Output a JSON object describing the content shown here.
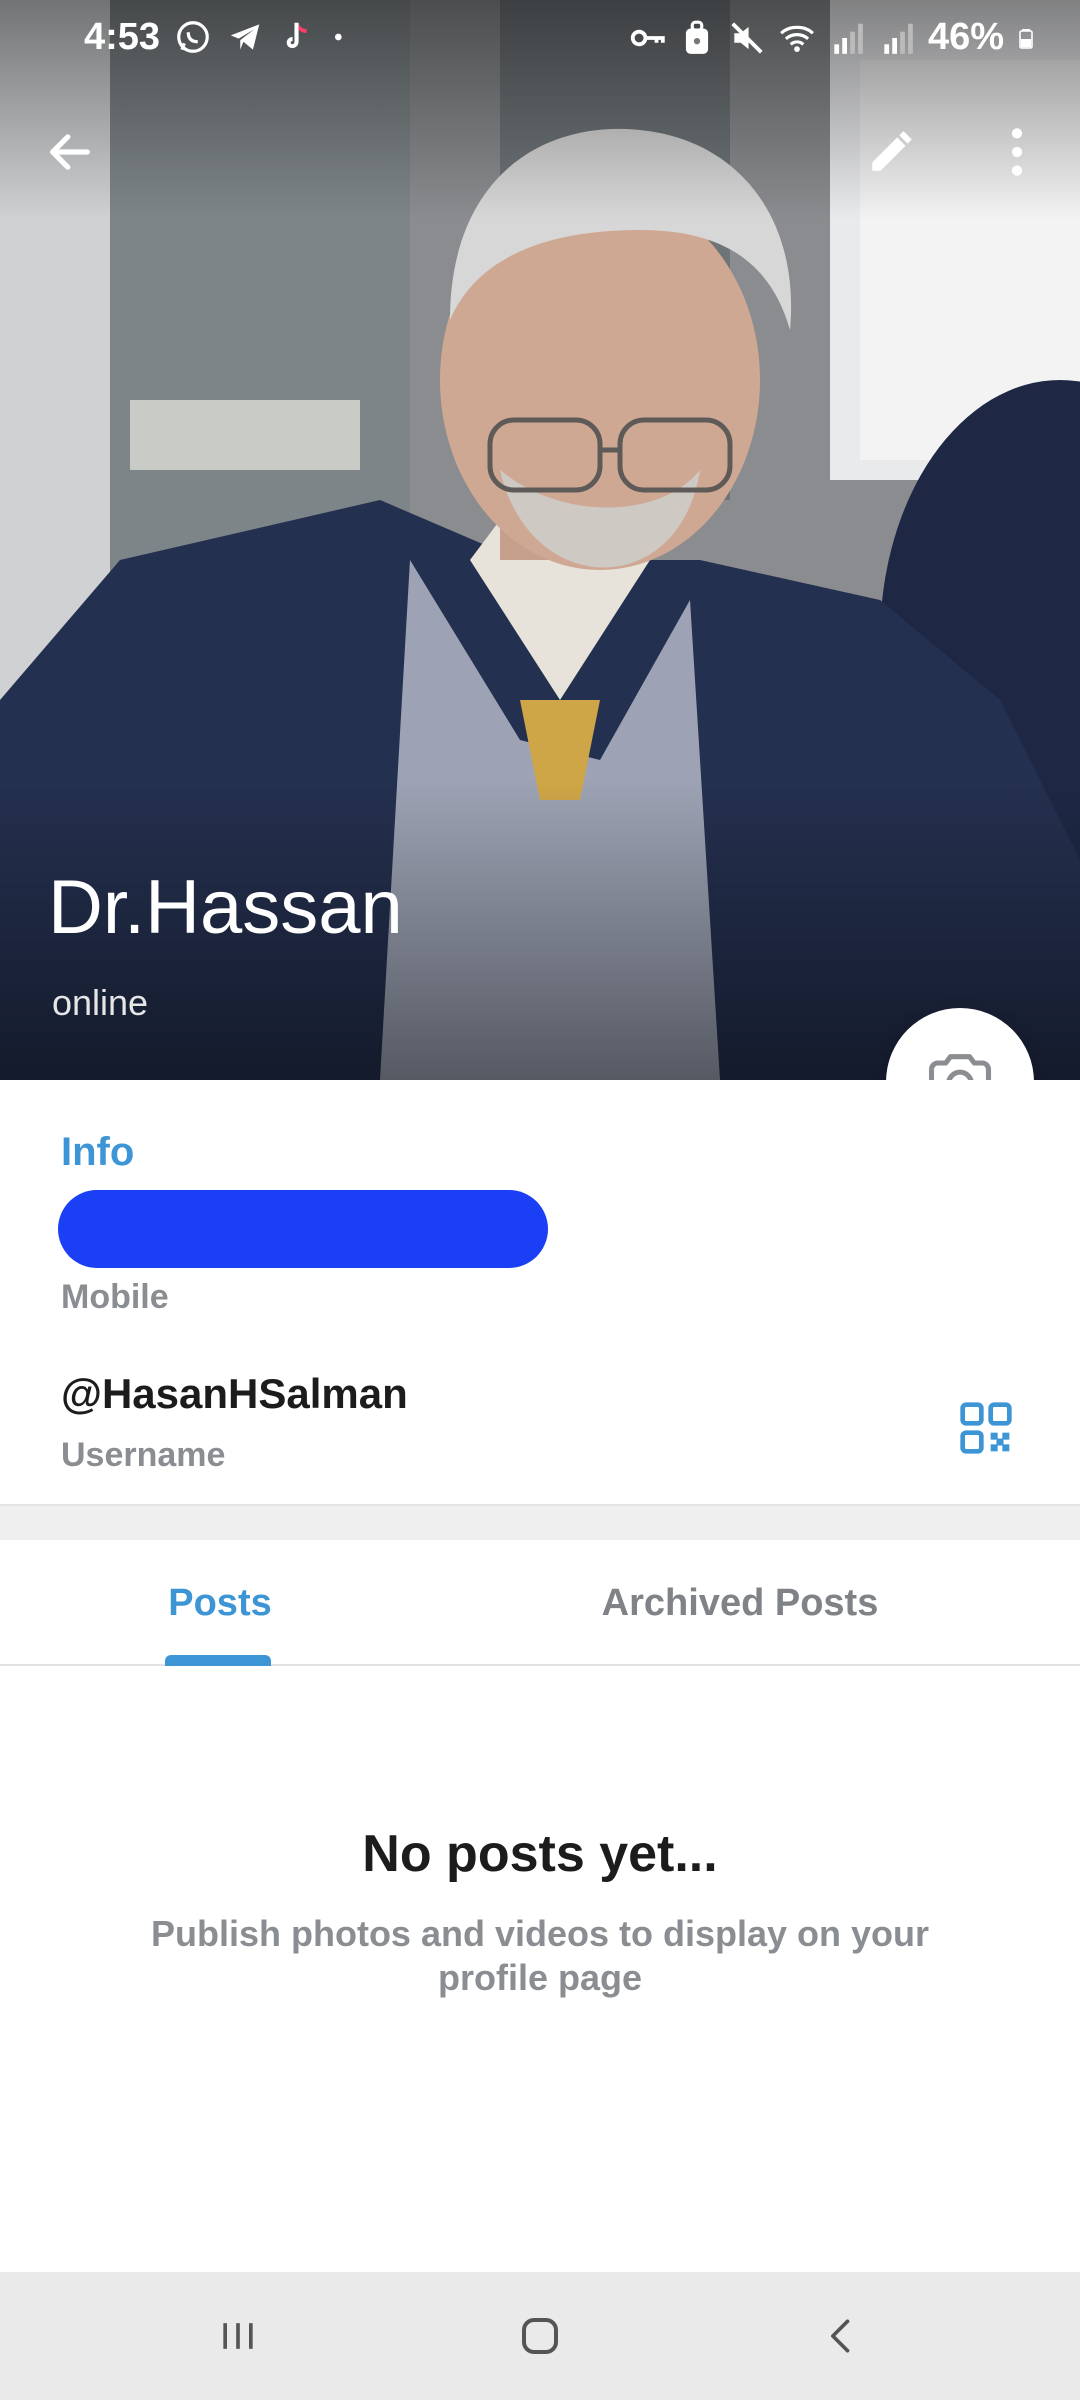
{
  "status_bar": {
    "time": "4:53",
    "battery_percent": "46%",
    "left_icons": [
      "whatsapp-icon",
      "telegram-icon",
      "tiktok-icon",
      "dot-icon"
    ],
    "right_icons": [
      "vpn-key-icon",
      "secure-folder-icon",
      "mute-icon",
      "wifi-icon",
      "signal-icon",
      "signal-icon",
      "battery-icon"
    ]
  },
  "header": {
    "back_icon": "arrow-left-icon",
    "edit_icon": "pencil-icon",
    "more_icon": "more-vertical-icon"
  },
  "profile": {
    "name": "Dr.Hassan",
    "status": "online",
    "camera_icon": "camera-add-icon"
  },
  "info": {
    "title": "Info",
    "mobile_label": "Mobile",
    "username": "@HasanHSalman",
    "username_label": "Username",
    "qr_icon": "qr-code-icon"
  },
  "tabs": [
    {
      "label": "Posts",
      "active": true
    },
    {
      "label": "Archived Posts",
      "active": false
    }
  ],
  "empty_state": {
    "title": "No posts yet...",
    "description": "Publish photos and videos to display on your profile page"
  },
  "nav_bar": {
    "recents_icon": "recents-icon",
    "home_icon": "home-icon",
    "back_icon": "back-chevron-icon"
  },
  "colors": {
    "accent": "#3d95d6",
    "redaction": "#1a3ff5",
    "secondary_text": "#8a8d91"
  }
}
